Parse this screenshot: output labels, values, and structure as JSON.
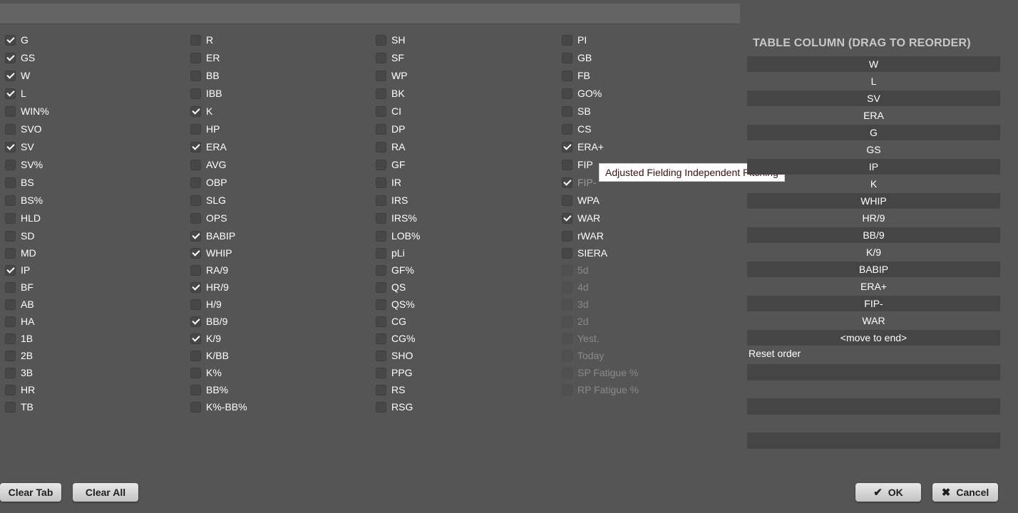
{
  "columns": [
    [
      {
        "label": "G",
        "checked": true
      },
      {
        "label": "GS",
        "checked": true
      },
      {
        "label": "W",
        "checked": true
      },
      {
        "label": "L",
        "checked": true
      },
      {
        "label": "WIN%",
        "checked": false
      },
      {
        "label": "SVO",
        "checked": false
      },
      {
        "label": "SV",
        "checked": true
      },
      {
        "label": "SV%",
        "checked": false
      },
      {
        "label": "BS",
        "checked": false
      },
      {
        "label": "BS%",
        "checked": false
      },
      {
        "label": "HLD",
        "checked": false
      },
      {
        "label": "SD",
        "checked": false
      },
      {
        "label": "MD",
        "checked": false
      },
      {
        "label": "IP",
        "checked": true
      },
      {
        "label": "BF",
        "checked": false
      },
      {
        "label": "AB",
        "checked": false
      },
      {
        "label": "HA",
        "checked": false
      },
      {
        "label": "1B",
        "checked": false
      },
      {
        "label": "2B",
        "checked": false
      },
      {
        "label": "3B",
        "checked": false
      },
      {
        "label": "HR",
        "checked": false
      },
      {
        "label": "TB",
        "checked": false
      }
    ],
    [
      {
        "label": "R",
        "checked": false
      },
      {
        "label": "ER",
        "checked": false
      },
      {
        "label": "BB",
        "checked": false
      },
      {
        "label": "IBB",
        "checked": false
      },
      {
        "label": "K",
        "checked": true
      },
      {
        "label": "HP",
        "checked": false
      },
      {
        "label": "ERA",
        "checked": true
      },
      {
        "label": "AVG",
        "checked": false
      },
      {
        "label": "OBP",
        "checked": false
      },
      {
        "label": "SLG",
        "checked": false
      },
      {
        "label": "OPS",
        "checked": false
      },
      {
        "label": "BABIP",
        "checked": true
      },
      {
        "label": "WHIP",
        "checked": true
      },
      {
        "label": "RA/9",
        "checked": false
      },
      {
        "label": "HR/9",
        "checked": true
      },
      {
        "label": "H/9",
        "checked": false
      },
      {
        "label": "BB/9",
        "checked": true
      },
      {
        "label": "K/9",
        "checked": true
      },
      {
        "label": "K/BB",
        "checked": false
      },
      {
        "label": "K%",
        "checked": false
      },
      {
        "label": "BB%",
        "checked": false
      },
      {
        "label": "K%-BB%",
        "checked": false
      }
    ],
    [
      {
        "label": "SH",
        "checked": false
      },
      {
        "label": "SF",
        "checked": false
      },
      {
        "label": "WP",
        "checked": false
      },
      {
        "label": "BK",
        "checked": false
      },
      {
        "label": "CI",
        "checked": false
      },
      {
        "label": "DP",
        "checked": false
      },
      {
        "label": "RA",
        "checked": false
      },
      {
        "label": "GF",
        "checked": false
      },
      {
        "label": "IR",
        "checked": false
      },
      {
        "label": "IRS",
        "checked": false
      },
      {
        "label": "IRS%",
        "checked": false
      },
      {
        "label": "LOB%",
        "checked": false
      },
      {
        "label": "pLi",
        "checked": false
      },
      {
        "label": "GF%",
        "checked": false
      },
      {
        "label": "QS",
        "checked": false
      },
      {
        "label": "QS%",
        "checked": false
      },
      {
        "label": "CG",
        "checked": false
      },
      {
        "label": "CG%",
        "checked": false
      },
      {
        "label": "SHO",
        "checked": false
      },
      {
        "label": "PPG",
        "checked": false
      },
      {
        "label": "RS",
        "checked": false
      },
      {
        "label": "RSG",
        "checked": false
      }
    ],
    [
      {
        "label": "PI",
        "checked": false
      },
      {
        "label": "GB",
        "checked": false
      },
      {
        "label": "FB",
        "checked": false
      },
      {
        "label": "GO%",
        "checked": false
      },
      {
        "label": "SB",
        "checked": false
      },
      {
        "label": "CS",
        "checked": false
      },
      {
        "label": "ERA+",
        "checked": true
      },
      {
        "label": "FIP",
        "checked": false
      },
      {
        "label": "FIP-",
        "checked": true,
        "hover": true
      },
      {
        "label": "WPA",
        "checked": false
      },
      {
        "label": "WAR",
        "checked": true
      },
      {
        "label": "rWAR",
        "checked": false
      },
      {
        "label": "SIERA",
        "checked": false
      },
      {
        "label": "5d",
        "checked": false,
        "disabled": true
      },
      {
        "label": "4d",
        "checked": false,
        "disabled": true
      },
      {
        "label": "3d",
        "checked": false,
        "disabled": true
      },
      {
        "label": "2d",
        "checked": false,
        "disabled": true
      },
      {
        "label": "Yest.",
        "checked": false,
        "disabled": true
      },
      {
        "label": "Today",
        "checked": false,
        "disabled": true
      },
      {
        "label": "SP Fatigue %",
        "checked": false,
        "disabled": true
      },
      {
        "label": "RP Fatigue %",
        "checked": false,
        "disabled": true
      }
    ]
  ],
  "tooltip": "Adjusted Fielding Independent Pitching",
  "order_panel": {
    "title": "TABLE COLUMN (DRAG TO REORDER)",
    "items": [
      "W",
      "L",
      "SV",
      "ERA",
      "G",
      "GS",
      "IP",
      "K",
      "WHIP",
      "HR/9",
      "BB/9",
      "K/9",
      "BABIP",
      "ERA+",
      "FIP-",
      "WAR",
      "<move to end>"
    ],
    "reset_label": "Reset order"
  },
  "buttons": {
    "clear_tab": "Clear Tab",
    "clear_all": "Clear All",
    "ok": "OK",
    "cancel": "Cancel"
  },
  "icons": {
    "ok": "check-icon",
    "cancel": "x-icon"
  }
}
